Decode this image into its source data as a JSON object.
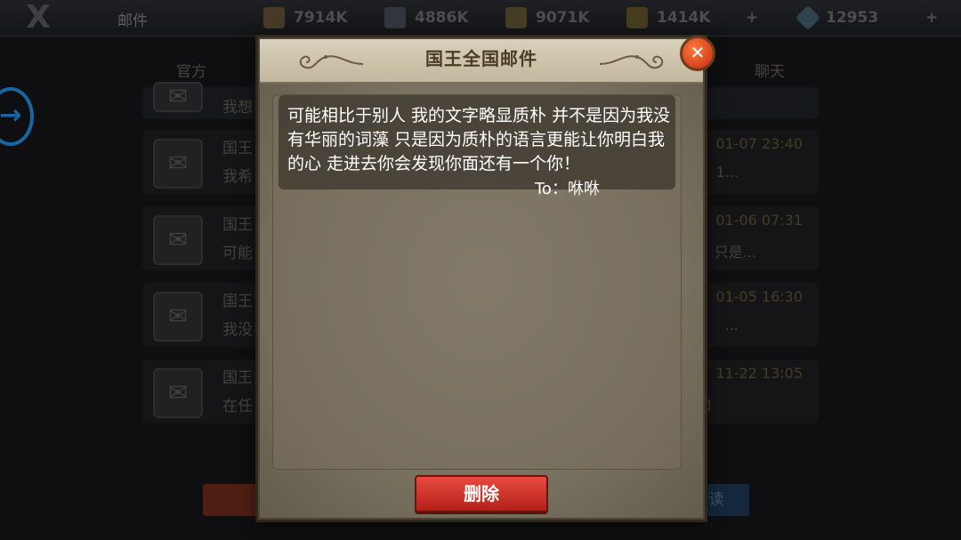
{
  "topbar": {
    "title": "邮件",
    "resources": [
      {
        "name": "food",
        "value": "7914K",
        "color": "#6b5a3a"
      },
      {
        "name": "iron",
        "value": "4886K",
        "color": "#4d5060"
      },
      {
        "name": "stone",
        "value": "9071K",
        "color": "#6a5c2e"
      },
      {
        "name": "gold",
        "value": "1414K",
        "color": "#6a5a2a"
      },
      {
        "name": "diamond",
        "value": "12953",
        "color": "#4a6a7a"
      }
    ]
  },
  "background": {
    "tabs": [
      "官方",
      "聊天"
    ],
    "mails": [
      {
        "title": "国王",
        "preview": "我想",
        "time": "",
        "tail": ""
      },
      {
        "title": "国王",
        "preview": "我希",
        "time": "01-07 23:40",
        "tail": "1..."
      },
      {
        "title": "国王",
        "preview": "可能",
        "time": "01-06 07:31",
        "tail": "只是..."
      },
      {
        "title": "国王",
        "preview": "我没",
        "time": "01-05 16:30",
        "tail": "..."
      },
      {
        "title": "国王",
        "preview": "在任",
        "time": "11-22 13:05",
        "tail": "口"
      }
    ],
    "read_button": "读"
  },
  "dialog": {
    "title": "国王全国邮件",
    "close_icon": "close-icon",
    "message": "可能相比于别人 我的文字略显质朴 并不是因为我没有华丽的词藻 只是因为质朴的语言更能让你明白我的心 走进去你会发现你面还有一个你！",
    "message_to": "To：咻咻",
    "delete_label": "删除"
  },
  "colors": {
    "accent_blue": "#1f88d8",
    "delete_red": "#d23a2e",
    "parchment": "#8f8776"
  }
}
